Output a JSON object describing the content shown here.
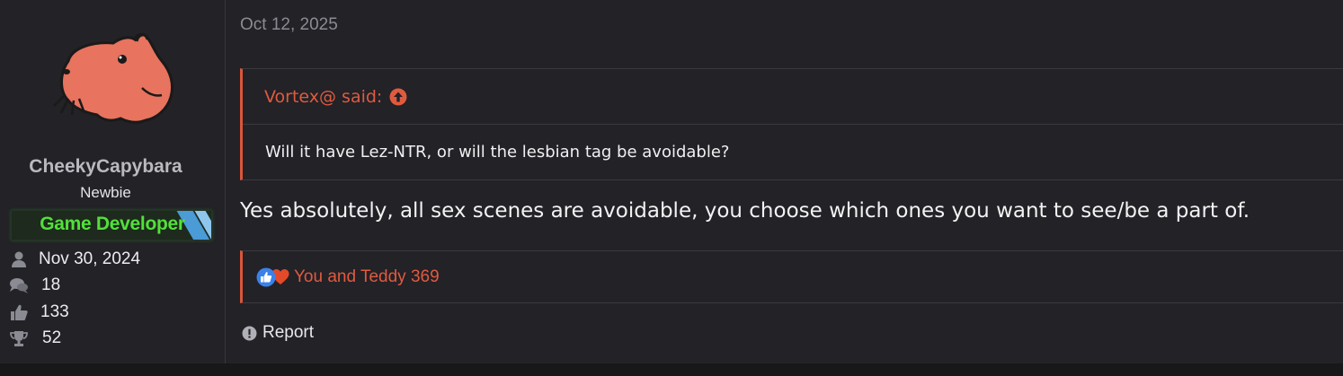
{
  "user": {
    "name": "CheekyCapybara",
    "title": "Newbie",
    "banner": "Game Developer",
    "stats": {
      "joined": "Nov 30, 2024",
      "messages": "18",
      "reactions": "133",
      "points": "52"
    }
  },
  "post": {
    "date": "Oct 12, 2025",
    "quote": {
      "author": "Vortex@ said:",
      "text": "Will it have Lez-NTR, or will the lesbian tag be avoidable?"
    },
    "message": "Yes absolutely, all sex scenes are avoidable, you choose which ones you want to see/be a part of.",
    "reactions_text": "You and Teddy 369",
    "report_label": "Report"
  },
  "colors": {
    "accent": "#d9553b",
    "banner_green": "#52e03a",
    "background": "#222227",
    "avatar_fill": "#e8735e"
  },
  "icons": [
    "capybara-avatar",
    "user-icon",
    "comments-icon",
    "thumbs-up-icon",
    "trophy-icon",
    "arrow-up-circle-icon",
    "like-reaction-icon",
    "love-reaction-icon",
    "report-icon"
  ]
}
